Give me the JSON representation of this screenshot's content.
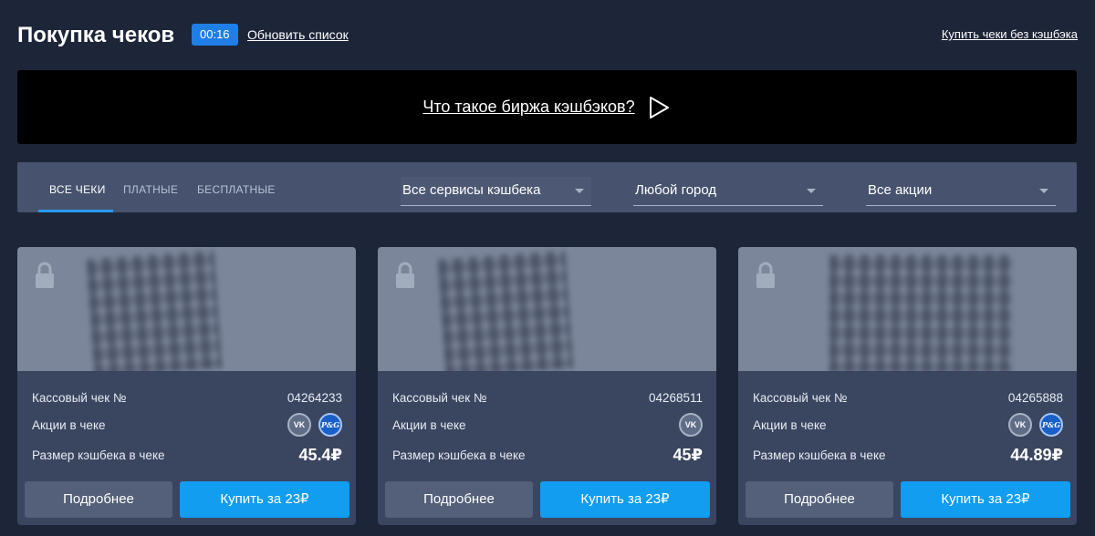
{
  "header": {
    "title": "Покупка чеков",
    "timer": "00:16",
    "refresh_label": "Обновить список",
    "no_cashback_label": "Купить чеки без кэшбэка"
  },
  "banner": {
    "link_label": "Что такое биржа кэшбэков?",
    "icon": "play-icon"
  },
  "filters": {
    "tabs": [
      {
        "label": "Все чеки",
        "active": true
      },
      {
        "label": "Платные",
        "active": false
      },
      {
        "label": "Бесплатные",
        "active": false
      }
    ],
    "service_select": "Все сервисы кэшбека",
    "city_select": "Любой город",
    "promo_select": "Все акции"
  },
  "cards": [
    {
      "receipt_label": "Кассовый чек №",
      "receipt_number": "04264233",
      "promos_label": "Акции в чеке",
      "promos": [
        "vk-icon",
        "pg-icon"
      ],
      "cashback_label": "Размер кэшбека в чеке",
      "cashback_value": "45.4₽",
      "details_label": "Подробнее",
      "buy_label": "Купить за 23₽"
    },
    {
      "receipt_label": "Кассовый чек №",
      "receipt_number": "04268511",
      "promos_label": "Акции в чеке",
      "promos": [
        "vk-icon"
      ],
      "cashback_label": "Размер кэшбека в чеке",
      "cashback_value": "45₽",
      "details_label": "Подробнее",
      "buy_label": "Купить за 23₽"
    },
    {
      "receipt_label": "Кассовый чек №",
      "receipt_number": "04265888",
      "promos_label": "Акции в чеке",
      "promos": [
        "vk-icon",
        "pg-icon"
      ],
      "cashback_label": "Размер кэшбека в чеке",
      "cashback_value": "44.89₽",
      "details_label": "Подробнее",
      "buy_label": "Купить за 23₽"
    }
  ],
  "colors": {
    "background": "#1d2538",
    "accent_blue": "#119df0",
    "timer_blue": "#1f7fe6",
    "card_bg": "#3a4560",
    "filter_bar_bg": "#47536e"
  }
}
